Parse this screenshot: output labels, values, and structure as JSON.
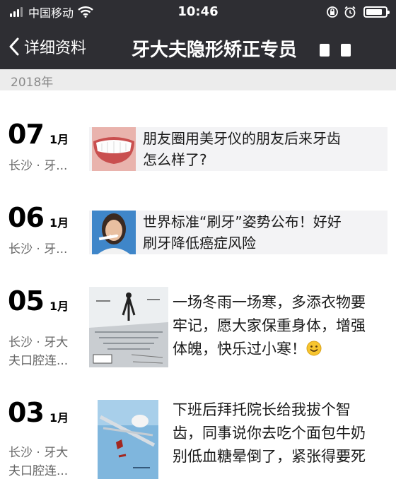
{
  "status": {
    "carrier": "中国移动",
    "time": "10:46",
    "battery_level": 0.85
  },
  "nav": {
    "back_label": "详细资料",
    "title": "牙大夫隐形矫正专员"
  },
  "timeline": {
    "year": "2018年",
    "posts": [
      {
        "day": "07",
        "month": "1月",
        "location": [
          "长沙 · 牙..."
        ],
        "text": [
          "朋友圈用美牙仪的朋友后来牙齿",
          "怎么样了?"
        ]
      },
      {
        "day": "06",
        "month": "1月",
        "location": [
          "长沙 · 牙..."
        ],
        "text": [
          "世界标准“刷牙”姿势公布！好好",
          "刷牙降低癌症风险"
        ]
      },
      {
        "day": "05",
        "month": "1月",
        "location": [
          "长沙 · 牙大",
          "夫口腔连..."
        ],
        "text": [
          "一场冬雨一场寒，多添衣物要",
          "牢记，愿大家保重身体，增强",
          "体魄，快乐过小寒！"
        ]
      },
      {
        "day": "03",
        "month": "1月",
        "location": [
          "长沙 · 牙大",
          "夫口腔连..."
        ],
        "text": [
          "下班后拜托院长给我拔个智",
          "齿，同事说你去吃个面包牛奶",
          "别低血糖晕倒了，紧张得要死"
        ]
      }
    ]
  }
}
